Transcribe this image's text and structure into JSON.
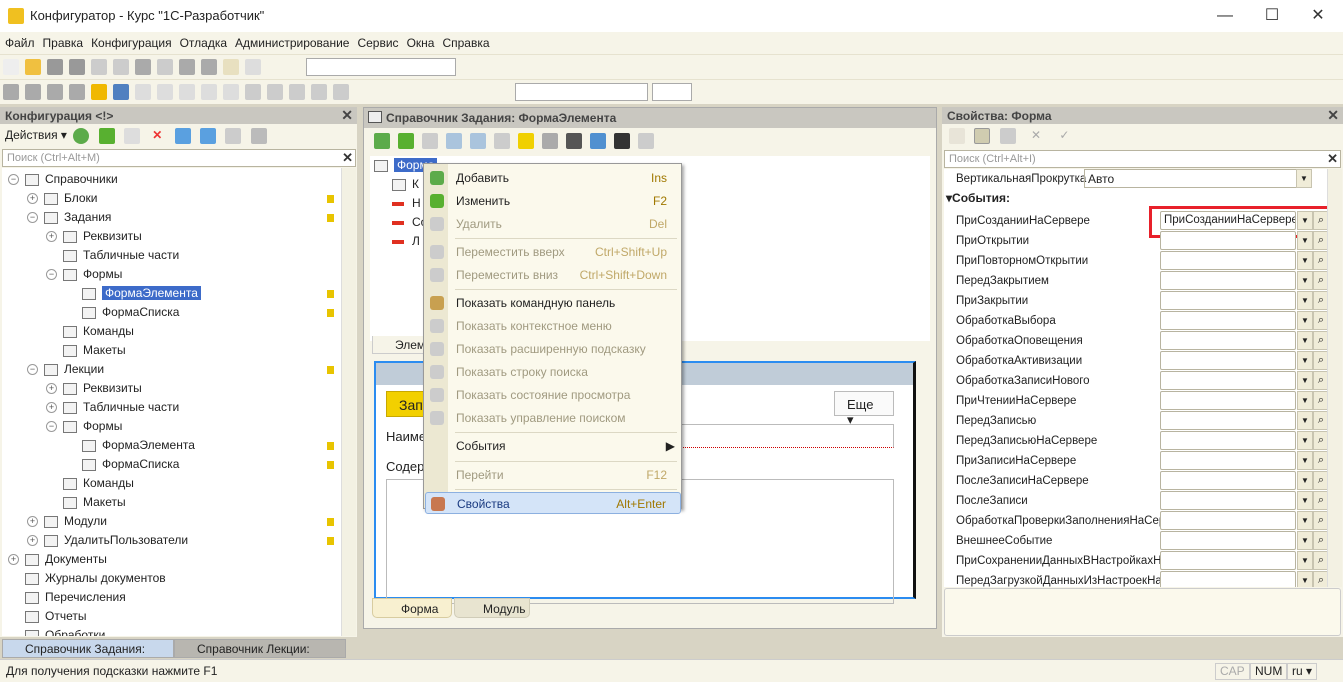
{
  "window": {
    "title": "Конфигуратор - Курс \"1С-Разработчик\"",
    "minimize": "—",
    "maximize": "☐",
    "close": "✕"
  },
  "menu": [
    "Файл",
    "Правка",
    "Конфигурация",
    "Отладка",
    "Администрирование",
    "Сервис",
    "Окна",
    "Справка"
  ],
  "left_panel": {
    "title": "Конфигурация <!>",
    "actions_label": "Действия",
    "search_placeholder": "Поиск (Ctrl+Alt+M)",
    "tree": [
      {
        "label": "Справочники",
        "level": 0,
        "toggle": "−"
      },
      {
        "label": "Блоки",
        "level": 1,
        "toggle": "+",
        "lock": true
      },
      {
        "label": "Задания",
        "level": 1,
        "toggle": "−",
        "lock": true
      },
      {
        "label": "Реквизиты",
        "level": 2,
        "toggle": "+"
      },
      {
        "label": "Табличные части",
        "level": 2
      },
      {
        "label": "Формы",
        "level": 2,
        "toggle": "−"
      },
      {
        "label": "ФормаЭлемента",
        "level": 3,
        "selected": true,
        "lock": true
      },
      {
        "label": "ФормаСписка",
        "level": 3,
        "lock": true
      },
      {
        "label": "Команды",
        "level": 2
      },
      {
        "label": "Макеты",
        "level": 2
      },
      {
        "label": "Лекции",
        "level": 1,
        "toggle": "−",
        "lock": true
      },
      {
        "label": "Реквизиты",
        "level": 2,
        "toggle": "+"
      },
      {
        "label": "Табличные части",
        "level": 2,
        "toggle": "+"
      },
      {
        "label": "Формы",
        "level": 2,
        "toggle": "−"
      },
      {
        "label": "ФормаЭлемента",
        "level": 3,
        "lock": true
      },
      {
        "label": "ФормаСписка",
        "level": 3,
        "lock": true
      },
      {
        "label": "Команды",
        "level": 2
      },
      {
        "label": "Макеты",
        "level": 2
      },
      {
        "label": "Модули",
        "level": 1,
        "toggle": "+",
        "lock": true
      },
      {
        "label": "УдалитьПользователи",
        "level": 1,
        "toggle": "+",
        "lock": true
      },
      {
        "label": "Документы",
        "level": 0,
        "toggle": "+"
      },
      {
        "label": "Журналы документов",
        "level": 0
      },
      {
        "label": "Перечисления",
        "level": 0
      },
      {
        "label": "Отчеты",
        "level": 0
      },
      {
        "label": "Обработки",
        "level": 0
      }
    ]
  },
  "center": {
    "title": "Справочник Задания: ФормаЭлемента",
    "tree": [
      "Форма",
      "К",
      "Н",
      "Со",
      "Л"
    ],
    "elements_tab": "Элем",
    "form": {
      "write_button": "Зап",
      "more_button": "Еще ▾",
      "name_label": "Наиме",
      "content_label": "Содер"
    },
    "tabs": [
      "Форма",
      "Модуль"
    ]
  },
  "context_menu": [
    {
      "label": "Добавить",
      "key": "Ins",
      "icon": "add-icon",
      "color": "#5cab4a"
    },
    {
      "label": "Изменить",
      "key": "F2",
      "icon": "pencil-icon",
      "color": "#58b030"
    },
    {
      "label": "Удалить",
      "key": "Del",
      "disabled": true,
      "icon": "delete-icon",
      "color": "#ccc"
    },
    {
      "sep": true
    },
    {
      "label": "Переместить вверх",
      "key": "Ctrl+Shift+Up",
      "disabled": true,
      "icon": "arrow-up-icon",
      "color": "#ccc"
    },
    {
      "label": "Переместить вниз",
      "key": "Ctrl+Shift+Down",
      "disabled": true,
      "icon": "arrow-down-icon",
      "color": "#ccc"
    },
    {
      "sep": true
    },
    {
      "label": "Показать командную панель",
      "icon": "command-panel-icon",
      "color": "#c8a050"
    },
    {
      "label": "Показать контекстное меню",
      "disabled": true,
      "icon": "context-menu-icon",
      "color": "#ccc"
    },
    {
      "label": "Показать расширенную подсказку",
      "disabled": true,
      "icon": "tooltip-icon",
      "color": "#ccc"
    },
    {
      "label": "Показать строку поиска",
      "disabled": true,
      "icon": "search-bar-icon",
      "color": "#ccc"
    },
    {
      "label": "Показать состояние просмотра",
      "disabled": true,
      "icon": "view-state-icon",
      "color": "#ccc"
    },
    {
      "label": "Показать управление поиском",
      "disabled": true,
      "icon": "search-control-icon",
      "color": "#ccc"
    },
    {
      "sep": true
    },
    {
      "label": "События",
      "submenu": true
    },
    {
      "sep": true
    },
    {
      "label": "Перейти",
      "key": "F12",
      "disabled": true
    },
    {
      "sep": true
    },
    {
      "label": "Свойства",
      "key": "Alt+Enter",
      "highlighted": true,
      "icon": "properties-icon",
      "color": "#c87850"
    }
  ],
  "right_panel": {
    "title": "Свойства: Форма",
    "search_placeholder": "Поиск (Ctrl+Alt+I)",
    "vscroll_label": "ВертикальнаяПрокрутка",
    "vscroll_value": "Авто",
    "events_header": "События:",
    "events": [
      {
        "name": "ПриСозданииНаСервере",
        "value": "ПриСозданииНаСервере",
        "highlighted": true
      },
      {
        "name": "ПриОткрытии",
        "value": ""
      },
      {
        "name": "ПриПовторномОткрытии",
        "value": ""
      },
      {
        "name": "ПередЗакрытием",
        "value": ""
      },
      {
        "name": "ПриЗакрытии",
        "value": ""
      },
      {
        "name": "ОбработкаВыбора",
        "value": ""
      },
      {
        "name": "ОбработкаОповещения",
        "value": ""
      },
      {
        "name": "ОбработкаАктивизации",
        "value": ""
      },
      {
        "name": "ОбработкаЗаписиНового",
        "value": ""
      },
      {
        "name": "ПриЧтенииНаСервере",
        "value": ""
      },
      {
        "name": "ПередЗаписью",
        "value": ""
      },
      {
        "name": "ПередЗаписьюНаСервере",
        "value": ""
      },
      {
        "name": "ПриЗаписиНаСервере",
        "value": ""
      },
      {
        "name": "ПослеЗаписиНаСервере",
        "value": ""
      },
      {
        "name": "ПослеЗаписи",
        "value": ""
      },
      {
        "name": "ОбработкаПроверкиЗаполненияНаСервере",
        "value": ""
      },
      {
        "name": "ВнешнееСобытие",
        "value": ""
      },
      {
        "name": "ПриСохраненииДанныхВНастройкахНаСервере",
        "value": ""
      },
      {
        "name": "ПередЗагрузкойДанныхИзНастроекНаСервере",
        "value": ""
      }
    ],
    "highlight_color": "#e8202a"
  },
  "taskbar": [
    "Справочник Задания: Форм...",
    "Справочник Лекции: Форма..."
  ],
  "status": {
    "hint": "Для получения подсказки нажмите F1",
    "cap": "CAP",
    "num": "NUM",
    "lang": "ru ▾"
  }
}
